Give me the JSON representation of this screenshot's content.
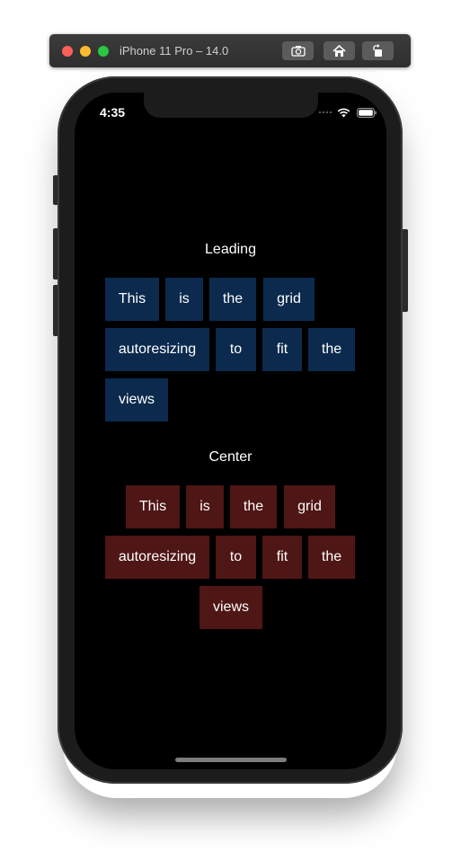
{
  "simulator": {
    "title": "iPhone 11 Pro – 14.0"
  },
  "status_bar": {
    "time": "4:35"
  },
  "sections": {
    "leading": {
      "title": "Leading",
      "words": [
        "This",
        "is",
        "the",
        "grid",
        "autoresizing",
        "to",
        "fit",
        "the",
        "views"
      ],
      "color": "#0b2a4d"
    },
    "center": {
      "title": "Center",
      "words": [
        "This",
        "is",
        "the",
        "grid",
        "autoresizing",
        "to",
        "fit",
        "the",
        "views"
      ],
      "color": "#4e1615"
    }
  }
}
